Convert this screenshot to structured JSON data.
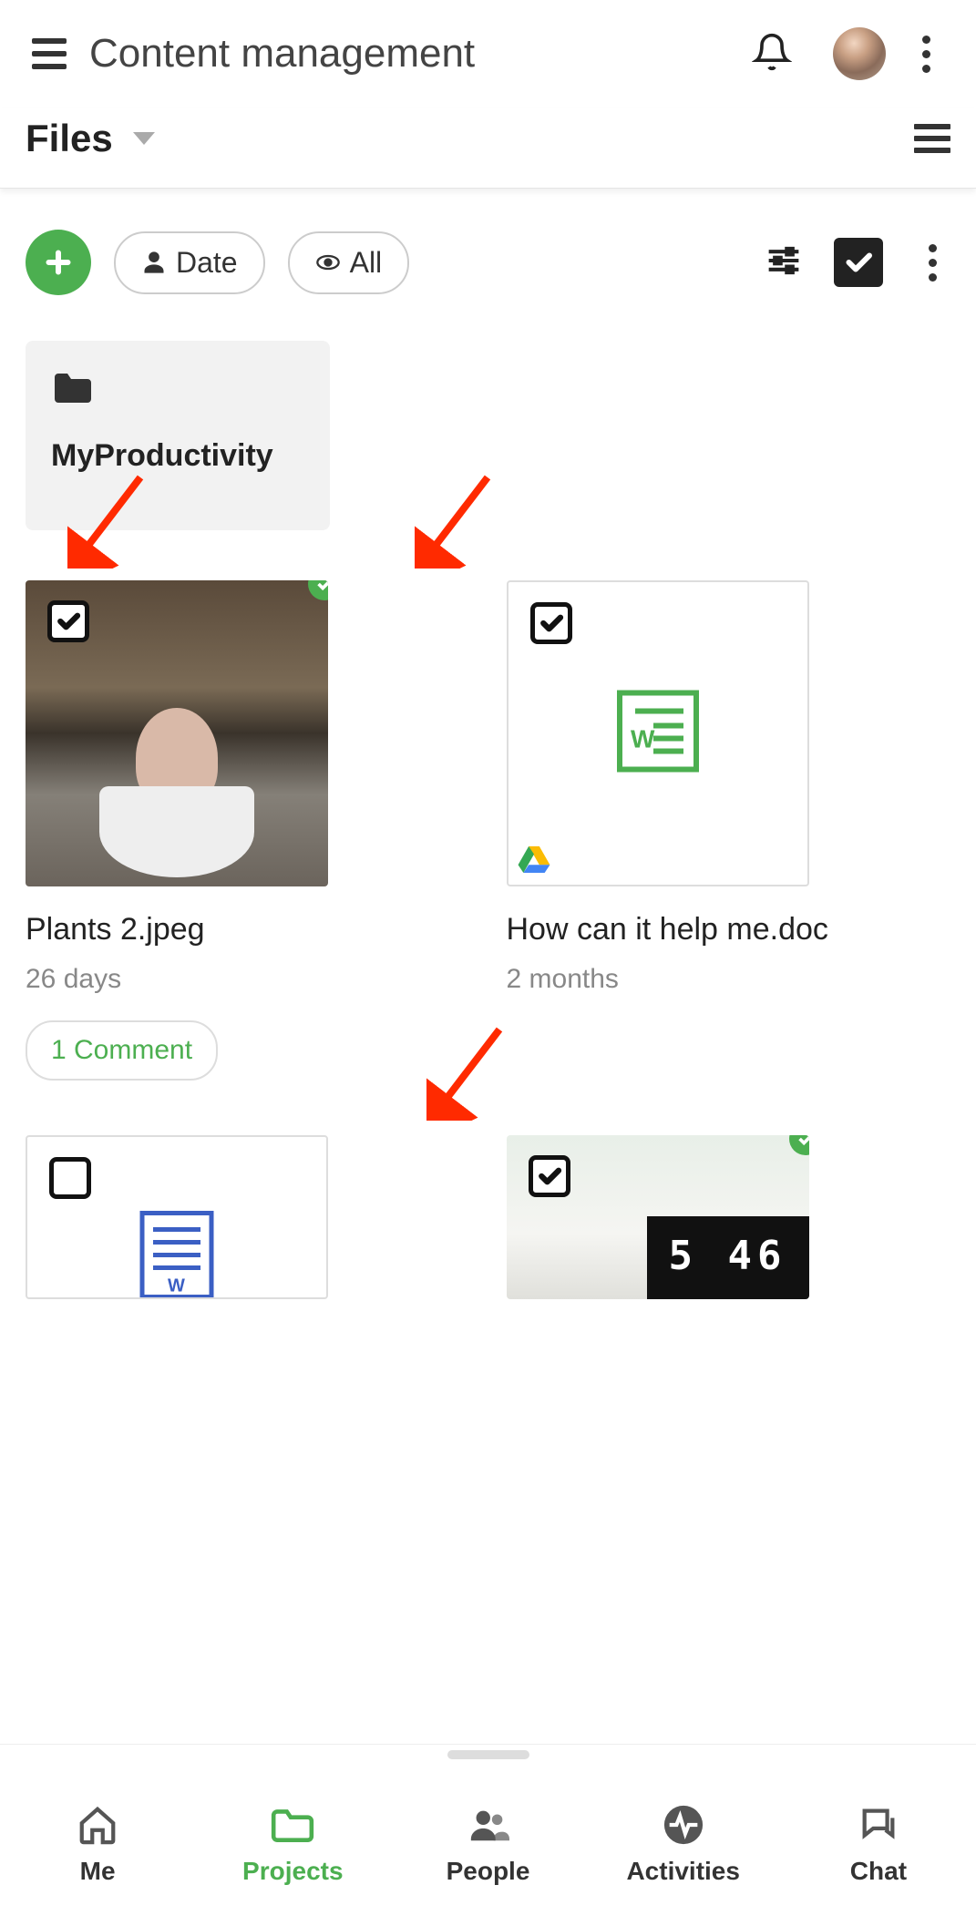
{
  "header": {
    "title": "Content management"
  },
  "subheader": {
    "title": "Files"
  },
  "toolbar": {
    "chips": {
      "date": "Date",
      "all": "All"
    }
  },
  "folders": [
    {
      "name": "MyProductivity"
    }
  ],
  "files": [
    {
      "name": "Plants 2.jpeg",
      "meta": "26 days",
      "comments": "1 Comment",
      "checked": true,
      "badge": true,
      "type": "image"
    },
    {
      "name": "How can it help me.doc",
      "meta": "2 months",
      "checked": true,
      "badge": false,
      "type": "gdoc"
    },
    {
      "name": "",
      "meta": "",
      "checked": false,
      "badge": false,
      "type": "wdoc"
    },
    {
      "name": "",
      "meta": "",
      "checked": true,
      "badge": true,
      "type": "image2"
    }
  ],
  "nav": {
    "items": [
      {
        "key": "me",
        "label": "Me"
      },
      {
        "key": "projects",
        "label": "Projects",
        "active": true
      },
      {
        "key": "people",
        "label": "People"
      },
      {
        "key": "activities",
        "label": "Activities"
      },
      {
        "key": "chat",
        "label": "Chat"
      }
    ]
  }
}
